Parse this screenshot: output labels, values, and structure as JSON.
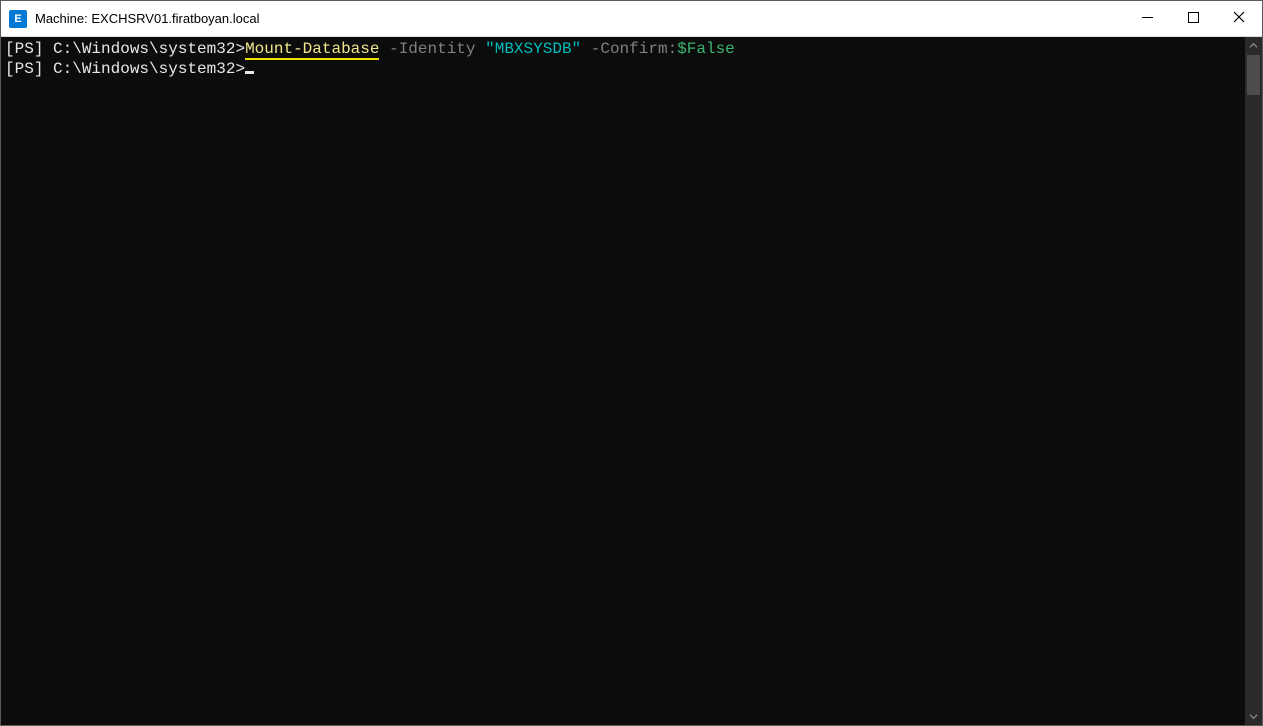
{
  "window": {
    "app_icon_letter": "E",
    "title": "Machine: EXCHSRV01.firatboyan.local"
  },
  "terminal": {
    "lines": [
      {
        "prefix_open": "[",
        "ps_tag": "PS",
        "prefix_close": "] ",
        "path": "C:\\Windows\\system32",
        "gt": ">",
        "cmdlet": "Mount-Database",
        "sp1": " ",
        "param1": "-Identity",
        "sp2": " ",
        "string1": "\"MBXSYSDB\"",
        "sp3": " ",
        "param2": "-Confirm:",
        "bool1": "$False"
      },
      {
        "prefix_open": "[",
        "ps_tag": "PS",
        "prefix_close": "] ",
        "path": "C:\\Windows\\system32",
        "gt": ">"
      }
    ]
  }
}
